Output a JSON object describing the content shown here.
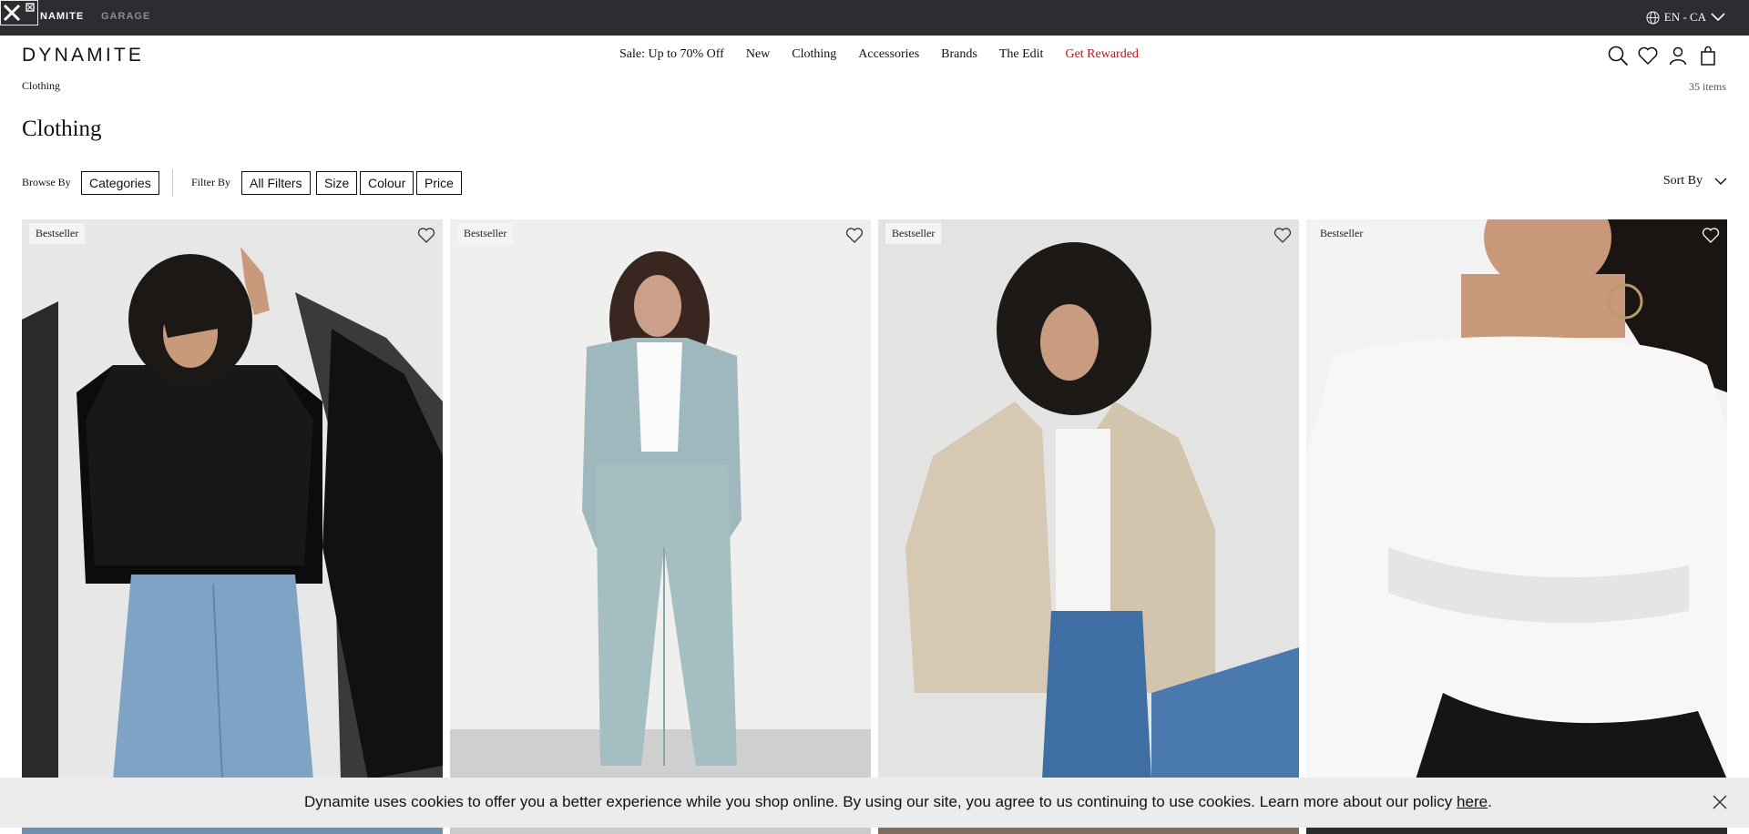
{
  "topbar": {
    "brands": [
      "NAMITE",
      "GARAGE"
    ],
    "language": "EN - CA"
  },
  "header": {
    "logo": "DYNAMITE",
    "nav": [
      {
        "label": "Sale: Up to 70% Off"
      },
      {
        "label": "New"
      },
      {
        "label": "Clothing"
      },
      {
        "label": "Accessories"
      },
      {
        "label": "Brands"
      },
      {
        "label": "The Edit"
      },
      {
        "label": "Get Rewarded",
        "color": "#c0141f"
      }
    ],
    "icons": [
      "search-icon",
      "heart-icon",
      "account-icon",
      "bag-icon"
    ]
  },
  "breadcrumb": "Clothing",
  "item_count": "35 items",
  "page_title": "Clothing",
  "filters": {
    "browse_label": "Browse By",
    "browse_button": "Categories",
    "filter_label": "Filter By",
    "buttons": [
      "All Filters",
      "Size",
      "Colour",
      "Price"
    ],
    "sort_label": "Sort By"
  },
  "products": [
    {
      "badge": "Bestseller"
    },
    {
      "badge": "Bestseller"
    },
    {
      "badge": "Bestseller"
    },
    {
      "badge": "Bestseller"
    }
  ],
  "cookie": {
    "text": "Dynamite uses cookies to offer you a better experience while you shop online. By using our site, you agree to us continuing to use cookies. Learn more about our policy ",
    "link": "here",
    "suffix": "."
  },
  "colors": {
    "topbar": "#2b2d31",
    "accent_red": "#c0141f",
    "cookie_bg": "#ececec"
  }
}
